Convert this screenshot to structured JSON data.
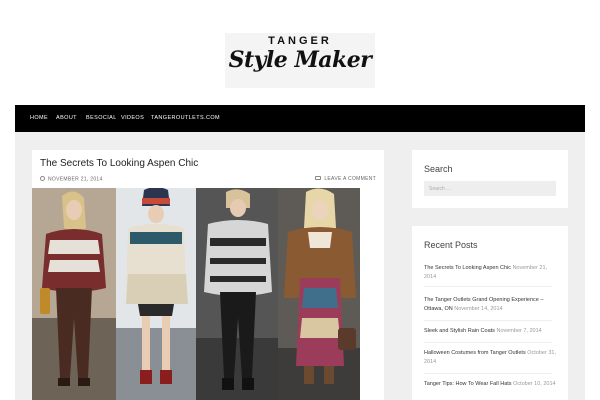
{
  "site": {
    "logo_top": "TANGER",
    "logo_script": "Style Maker"
  },
  "nav": {
    "items": [
      {
        "label": "HOME"
      },
      {
        "label": "ABOUT"
      },
      {
        "label": "BESOCIAL"
      },
      {
        "label": "VIDEOS"
      },
      {
        "label": "TANGEROUTLETS.COM"
      }
    ]
  },
  "post": {
    "title": "The Secrets To Looking Aspen Chic",
    "date": "NOVEMBER 21, 2014",
    "comment_link": "LEAVE A COMMENT",
    "date_icon": "clock-icon",
    "comment_icon": "comment-bubble-icon"
  },
  "sidebar": {
    "search": {
      "title": "Search",
      "placeholder": "Search …"
    },
    "recent": {
      "title": "Recent Posts",
      "posts": [
        {
          "title": "The Secrets To Looking Aspen Chic",
          "date": "November 21, 2014"
        },
        {
          "title": "The Tanger Outlets Grand Opening Experience – Ottawa, ON",
          "date": "November 14, 2014"
        },
        {
          "title": "Sleek and Stylish Rain Coats",
          "date": "November 7, 2014"
        },
        {
          "title": "Halloween Costumes from Tanger Outlets",
          "date": "October 31, 2014"
        },
        {
          "title": "Tanger Tips: How To Wear Fall Hats",
          "date": "October 10, 2014"
        }
      ]
    }
  },
  "colors": {
    "nav_bg": "#000000",
    "page_bg": "#efefef",
    "card_bg": "#ffffff"
  }
}
